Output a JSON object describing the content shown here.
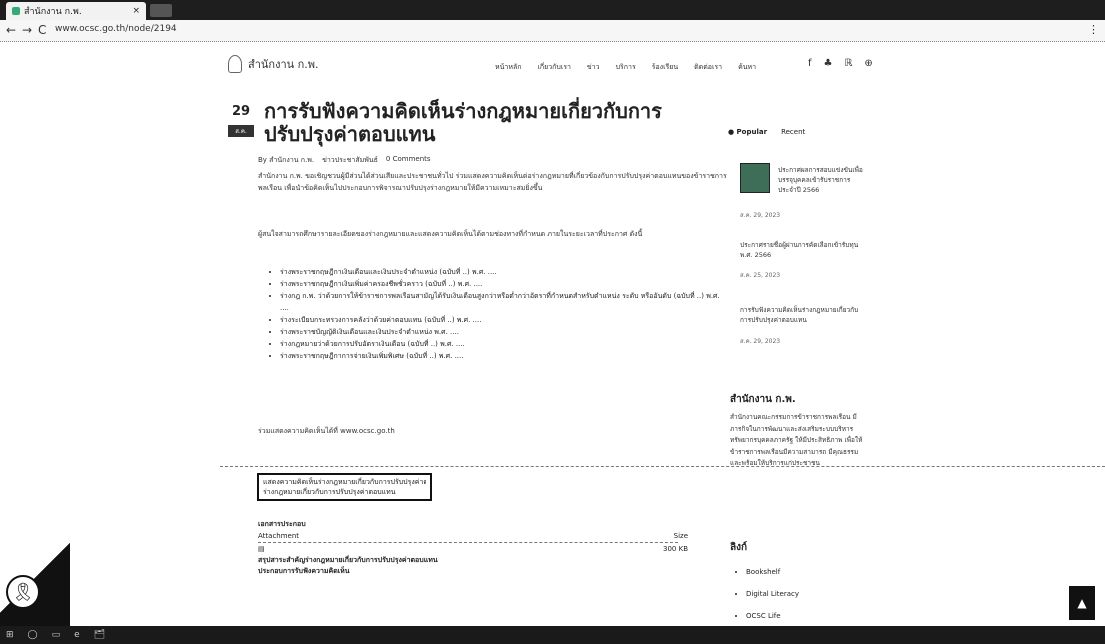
{
  "browser": {
    "tab_title": "สำนักงาน ก.พ.",
    "tab_close": "×",
    "back": "←",
    "forward": "→",
    "reload": "C",
    "url": "www.ocsc.go.th/node/2194",
    "menu": "⋮"
  },
  "site": {
    "logo_text": "สำนักงาน ก.พ.",
    "nav": [
      "หน้าหลัก",
      "เกี่ยวกับเรา",
      "ข่าว",
      "บริการ",
      "ร้องเรียน",
      "ติดต่อเรา",
      "ค้นหา"
    ],
    "icons": [
      "f",
      "♣",
      "ℝ",
      "⊕"
    ]
  },
  "post": {
    "day": "29",
    "month": "ส.ค.",
    "title": "การรับฟังความคิดเห็นร่างกฎหมายเกี่ยวกับการปรับปรุงค่าตอบแทน",
    "meta_author": "By สำนักงาน ก.พ.",
    "meta_category": "ข่าวประชาสัมพันธ์",
    "meta_comments": "0 Comments",
    "para1": "สำนักงาน ก.พ. ขอเชิญชวนผู้มีส่วนได้ส่วนเสียและประชาชนทั่วไป ร่วมแสดงความคิดเห็นต่อร่างกฎหมายที่เกี่ยวข้องกับการปรับปรุงค่าตอบแทนของข้าราชการพลเรือน เพื่อนำข้อคิดเห็นไปประกอบการพิจารณาปรับปรุงร่างกฎหมายให้มีความเหมาะสมยิ่งขึ้น",
    "para2": "ผู้สนใจสามารถศึกษารายละเอียดของร่างกฎหมายและแสดงความคิดเห็นได้ตามช่องทางที่กำหนด ภายในระยะเวลาที่ประกาศ ดังนี้",
    "bullets": [
      "ร่างพระราชกฤษฎีกาเงินเดือนและเงินประจำตำแหน่ง (ฉบับที่ ..) พ.ศ. ....",
      "ร่างพระราชกฤษฎีกาเงินเพิ่มค่าครองชีพชั่วคราว (ฉบับที่ ..) พ.ศ. ....",
      "ร่างกฎ ก.พ. ว่าด้วยการให้ข้าราชการพลเรือนสามัญได้รับเงินเดือนสูงกว่าหรือต่ำกว่าอัตราที่กำหนดสำหรับตำแหน่ง ระดับ หรืออันดับ (ฉบับที่ ..) พ.ศ. ....",
      "ร่างระเบียบกระทรวงการคลังว่าด้วยค่าตอบแทน (ฉบับที่ ..) พ.ศ. ....",
      "ร่างพระราชบัญญัติเงินเดือนและเงินประจำตำแหน่ง พ.ศ. ....",
      "ร่างกฎหมายว่าด้วยการปรับอัตราเงินเดือน (ฉบับที่ ..) พ.ศ. ....",
      "ร่างพระราชกฤษฎีกาการจ่ายเงินเพิ่มพิเศษ (ฉบับที่ ..) พ.ศ. ...."
    ],
    "feedback": "ร่วมแสดงความคิดเห็นได้ที่ www.ocsc.go.th",
    "box_links": [
      "แสดงความคิดเห็นร่างกฎหมายเกี่ยวกับการปรับปรุงค่าตอบแทน",
      "ร่างกฎหมายเกี่ยวกับการปรับปรุงค่าตอบแทน"
    ],
    "attach_heading": "เอกสารประกอบ",
    "attach_label": "Attachment",
    "size_label": "Size",
    "file_icon": "▤",
    "file_size": "300 KB",
    "file_name": "สรุปสาระสำคัญร่างกฎหมายเกี่ยวกับการปรับปรุงค่าตอบแทน",
    "file_name2": "ประกอบการรับฟังความคิดเห็น"
  },
  "sidebar": {
    "tab_popular": "● Popular",
    "tab_recent": "Recent",
    "item1": "ประกาศผลการสอบแข่งขันเพื่อบรรจุบุคคลเข้ารับราชการ ประจำปี 2566",
    "item1_date": "ส.ค. 29, 2023",
    "item2": "ประกาศรายชื่อผู้ผ่านการคัดเลือกเข้ารับทุน พ.ศ. 2566",
    "item2_date": "ส.ค. 25, 2023",
    "item3": "การรับฟังความคิดเห็นร่างกฎหมายเกี่ยวกับการปรับปรุงค่าตอบแทน",
    "item3_date": "ส.ค. 29, 2023",
    "about_heading": "สำนักงาน ก.พ.",
    "about_text": "สำนักงานคณะกรรมการข้าราชการพลเรือน มีภารกิจในการพัฒนาและส่งเสริมระบบบริหารทรัพยากรบุคคลภาครัฐ ให้มีประสิทธิภาพ เพื่อให้ข้าราชการพลเรือนมีความสามารถ มีคุณธรรม และพร้อมให้บริการแก่ประชาชน",
    "links_heading": "ลิงก์",
    "links": [
      "Bookshelf",
      "Digital Literacy",
      "OCSC Life"
    ]
  },
  "floating": {
    "ribbon_icon": "🎗",
    "top_icon": "▲"
  },
  "taskbar": {
    "items": [
      "⊞",
      "◯",
      "▭",
      "e",
      "🗂"
    ]
  }
}
